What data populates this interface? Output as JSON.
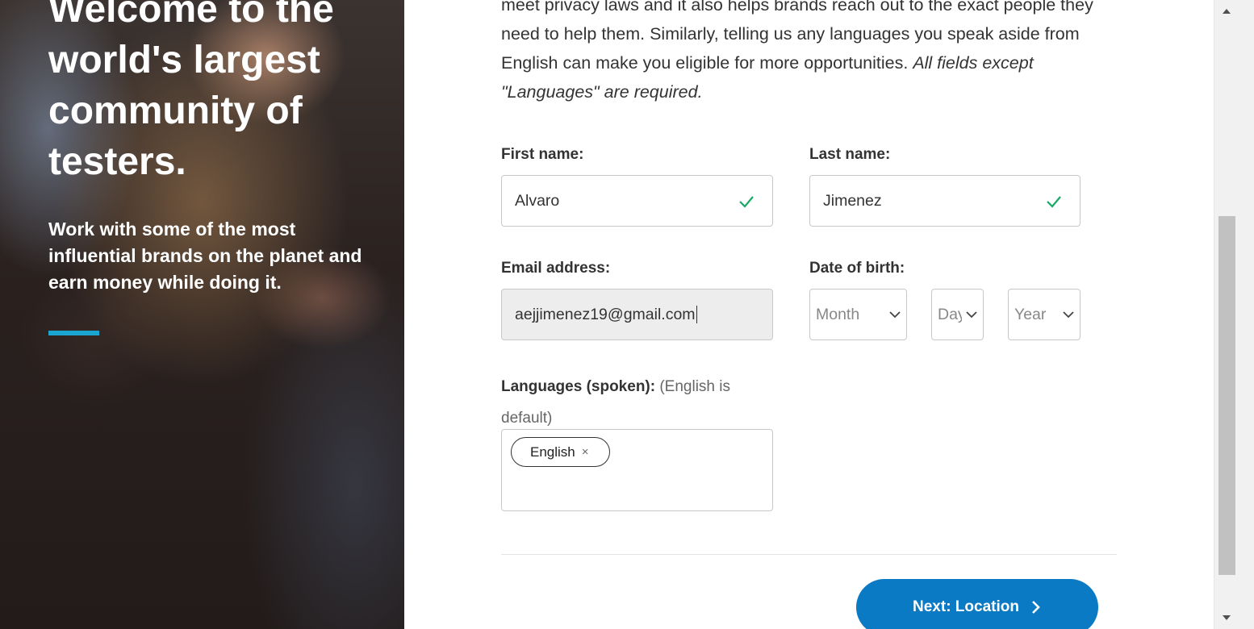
{
  "hero": {
    "title": "Welcome to the world's largest community of testers.",
    "subtitle": "Work with some of the most influential brands on the planet and earn money while doing it."
  },
  "intro": {
    "text": "meet privacy laws and it also helps brands reach out to the exact people they need to help them. Similarly, telling us any languages you speak aside from English can make you eligible for more opportunities.",
    "note": "All fields except \"Languages\" are required."
  },
  "form": {
    "first_name_label": "First name:",
    "first_name_value": "Alvaro",
    "last_name_label": "Last name:",
    "last_name_value": "Jimenez",
    "email_label": "Email address:",
    "email_value": "aejjimenez19@gmail.com",
    "dob_label": "Date of birth:",
    "month_placeholder": "Month",
    "day_placeholder": "Day",
    "year_placeholder": "Year",
    "languages_label": "Languages (spoken):",
    "languages_note": "(English is default)",
    "languages": [
      "English"
    ],
    "chip_remove": "×"
  },
  "actions": {
    "next_label": "Next: Location"
  },
  "colors": {
    "accent": "#1aa6d0",
    "button": "#0a7ac4",
    "valid_check": "#1aa866"
  },
  "icons": {
    "valid": "check-icon",
    "dropdown": "chevron-down-icon",
    "next": "chevron-right-icon",
    "remove": "close-icon"
  }
}
